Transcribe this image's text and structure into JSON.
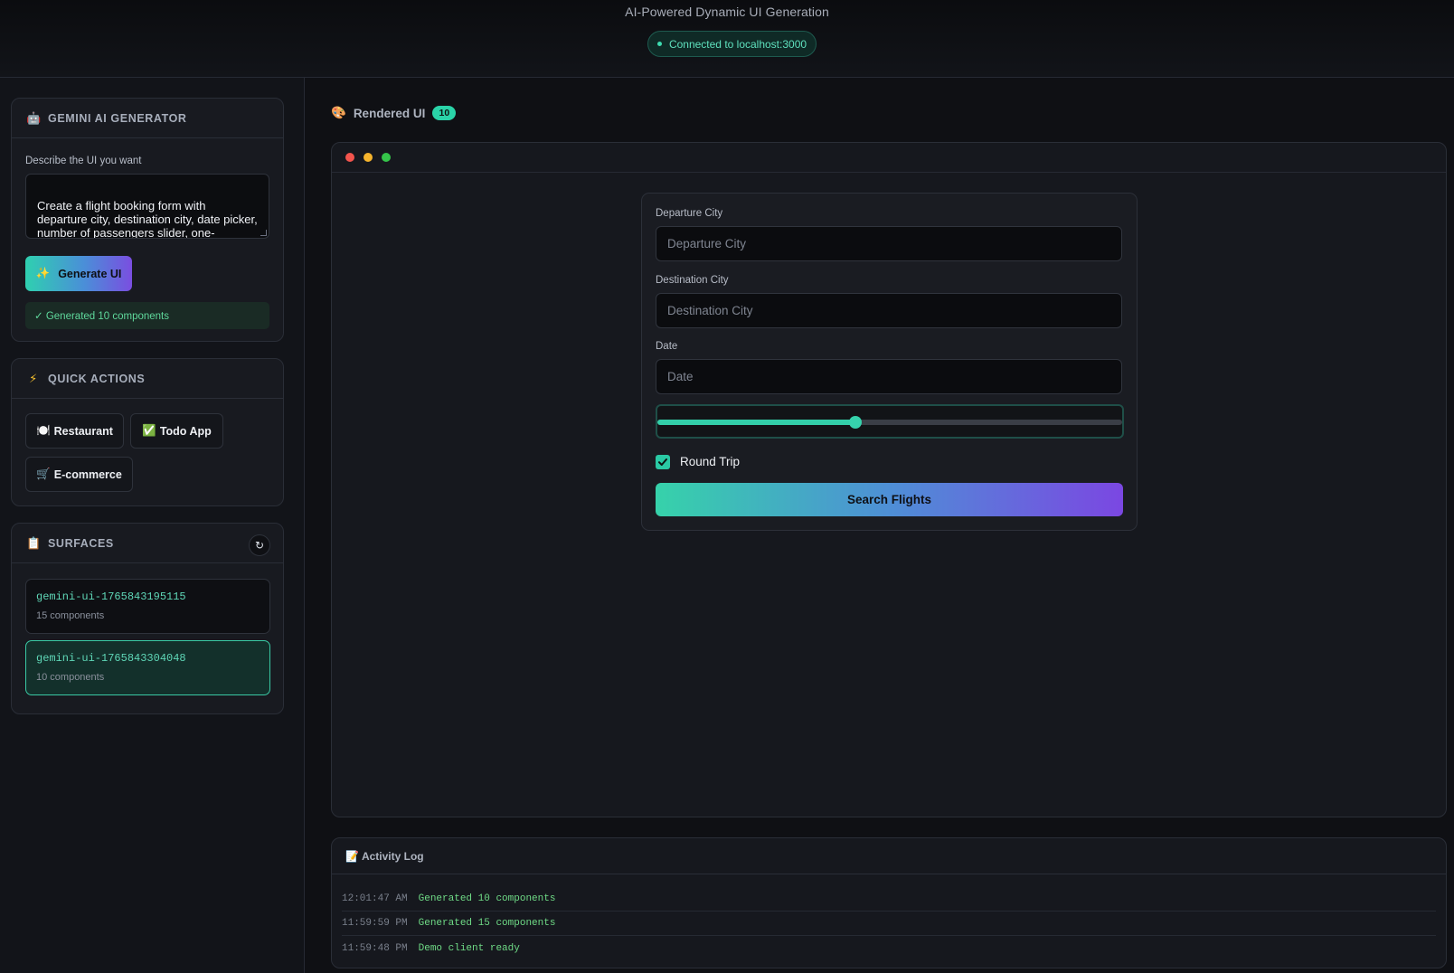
{
  "header": {
    "subtitle": "AI-Powered Dynamic UI Generation",
    "connection": "Connected to localhost:3000"
  },
  "sidebar": {
    "generator": {
      "icon": "robot-icon",
      "title": "GEMINI AI GENERATOR",
      "prompt_label": "Describe the UI you want",
      "prompt_value": "Create a flight booking form with departure city, destination city, date picker, number of passengers slider, one-way/round-trip checkbox, and search flights button",
      "generate_icon": "sparkles-icon",
      "generate_label": "Generate UI",
      "status": "✓ Generated 10 components"
    },
    "quick_actions": {
      "icon": "lightning-icon",
      "title": "QUICK ACTIONS",
      "items": [
        {
          "icon": "plate-icon",
          "glyph": "🍽️",
          "label": "Restaurant"
        },
        {
          "icon": "check-mark-icon",
          "glyph": "✅",
          "label": "Todo App"
        },
        {
          "icon": "cart-icon",
          "glyph": "🛒",
          "label": "E-commerce"
        }
      ]
    },
    "surfaces": {
      "icon": "clipboard-icon",
      "title": "SURFACES",
      "refresh_icon": "refresh-icon",
      "items": [
        {
          "id": "gemini-ui-1765843195115",
          "count": "15 components",
          "active": false
        },
        {
          "id": "gemini-ui-1765843304048",
          "count": "10 components",
          "active": true
        }
      ]
    }
  },
  "main": {
    "title_icon": "palette-icon",
    "title": "Rendered UI",
    "badge": "10",
    "form": {
      "departure_label": "Departure City",
      "departure_placeholder": "Departure City",
      "destination_label": "Destination City",
      "destination_placeholder": "Destination City",
      "date_label": "Date",
      "date_placeholder": "Date",
      "passengers_slider_fraction": 0.426,
      "round_trip_label": "Round Trip",
      "round_trip_checked": true,
      "search_label": "Search Flights"
    }
  },
  "activity_log": {
    "icon": "memo-icon",
    "title": "Activity Log",
    "entries": [
      {
        "time": "12:01:47 AM",
        "message": "Generated 10 components"
      },
      {
        "time": "11:59:59 PM",
        "message": "Generated 15 components"
      },
      {
        "time": "11:59:48 PM",
        "message": "Demo client ready"
      }
    ]
  },
  "colors": {
    "accent": "#2ad3a8",
    "accent_purple": "#7b47e2",
    "background": "#0f1014",
    "panel": "#181a20"
  }
}
